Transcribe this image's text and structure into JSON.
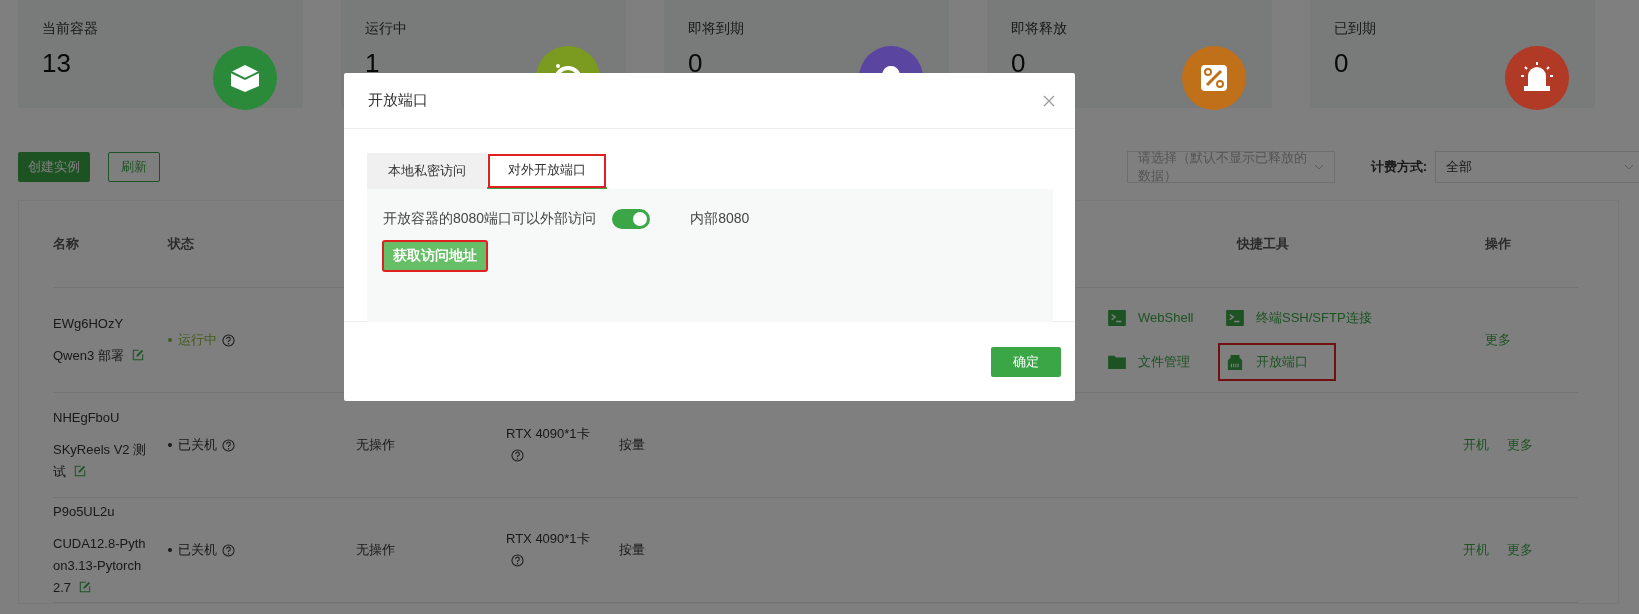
{
  "stats": [
    {
      "label": "当前容器",
      "value": "13",
      "kind": "box",
      "color": "#2a8a3a"
    },
    {
      "label": "运行中",
      "value": "1",
      "kind": "timer",
      "color": "#7a9a20"
    },
    {
      "label": "即将到期",
      "value": "0",
      "kind": "bell",
      "color": "#5a45a0"
    },
    {
      "label": "即将释放",
      "value": "0",
      "kind": "percent",
      "color": "#c07018"
    },
    {
      "label": "已到期",
      "value": "0",
      "kind": "alarm",
      "color": "#b03a25"
    }
  ],
  "toolbar": {
    "create_button": "创建实例",
    "refresh_button": "刷新",
    "filter_select": {
      "placeholder": "请选择（默认不显示已释放的数据）"
    },
    "billing_label": "计费方式:",
    "billing_select": {
      "value": "全部"
    }
  },
  "table": {
    "columns": {
      "name": "名称",
      "status": "状态",
      "tools": "快捷工具",
      "actions": "操作"
    },
    "rows": [
      {
        "name": "EWg6HOzY",
        "remark": "Qwen3 部署",
        "status": {
          "text": "运行中",
          "kind": "running"
        },
        "tools": [
          {
            "label": "WebShell",
            "kind": "terminal",
            "highlighted": false
          },
          {
            "label": "终端SSH/SFTP连接",
            "kind": "terminal",
            "highlighted": false
          },
          {
            "label": "文件管理",
            "kind": "folder",
            "highlighted": false
          },
          {
            "label": "开放端口",
            "kind": "port",
            "highlighted": true
          }
        ],
        "actions": [
          "更多"
        ]
      },
      {
        "name": "NHEgFboU",
        "remark": "SKyReels V2 测试",
        "status": {
          "text": "已关机",
          "kind": "stopped"
        },
        "column_3": "无操作",
        "column_4": "RTX 4090*1卡",
        "column_5": "按量",
        "actions": [
          "开机",
          "更多"
        ]
      },
      {
        "name": "P9o5UL2u",
        "remark": "CUDA12.8-Python3.13-Pytorch2.7",
        "status": {
          "text": "已关机",
          "kind": "stopped"
        },
        "column_3": "无操作",
        "column_4": "RTX 4090*1卡",
        "column_5": "按量",
        "actions": [
          "开机",
          "更多"
        ]
      }
    ]
  },
  "modal": {
    "title": "开放端口",
    "tabs": [
      {
        "label": "本地私密访问",
        "selected": false,
        "highlighted": false
      },
      {
        "label": "对外开放端口",
        "selected": true,
        "highlighted": true
      }
    ],
    "port_text": "开放容器的8080端口可以外部访问",
    "port_toggle": {
      "on": true
    },
    "internal_port": "内部8080",
    "fetch_button": {
      "label": "获取访问地址",
      "highlighted": true
    },
    "confirm_button": "确定"
  }
}
